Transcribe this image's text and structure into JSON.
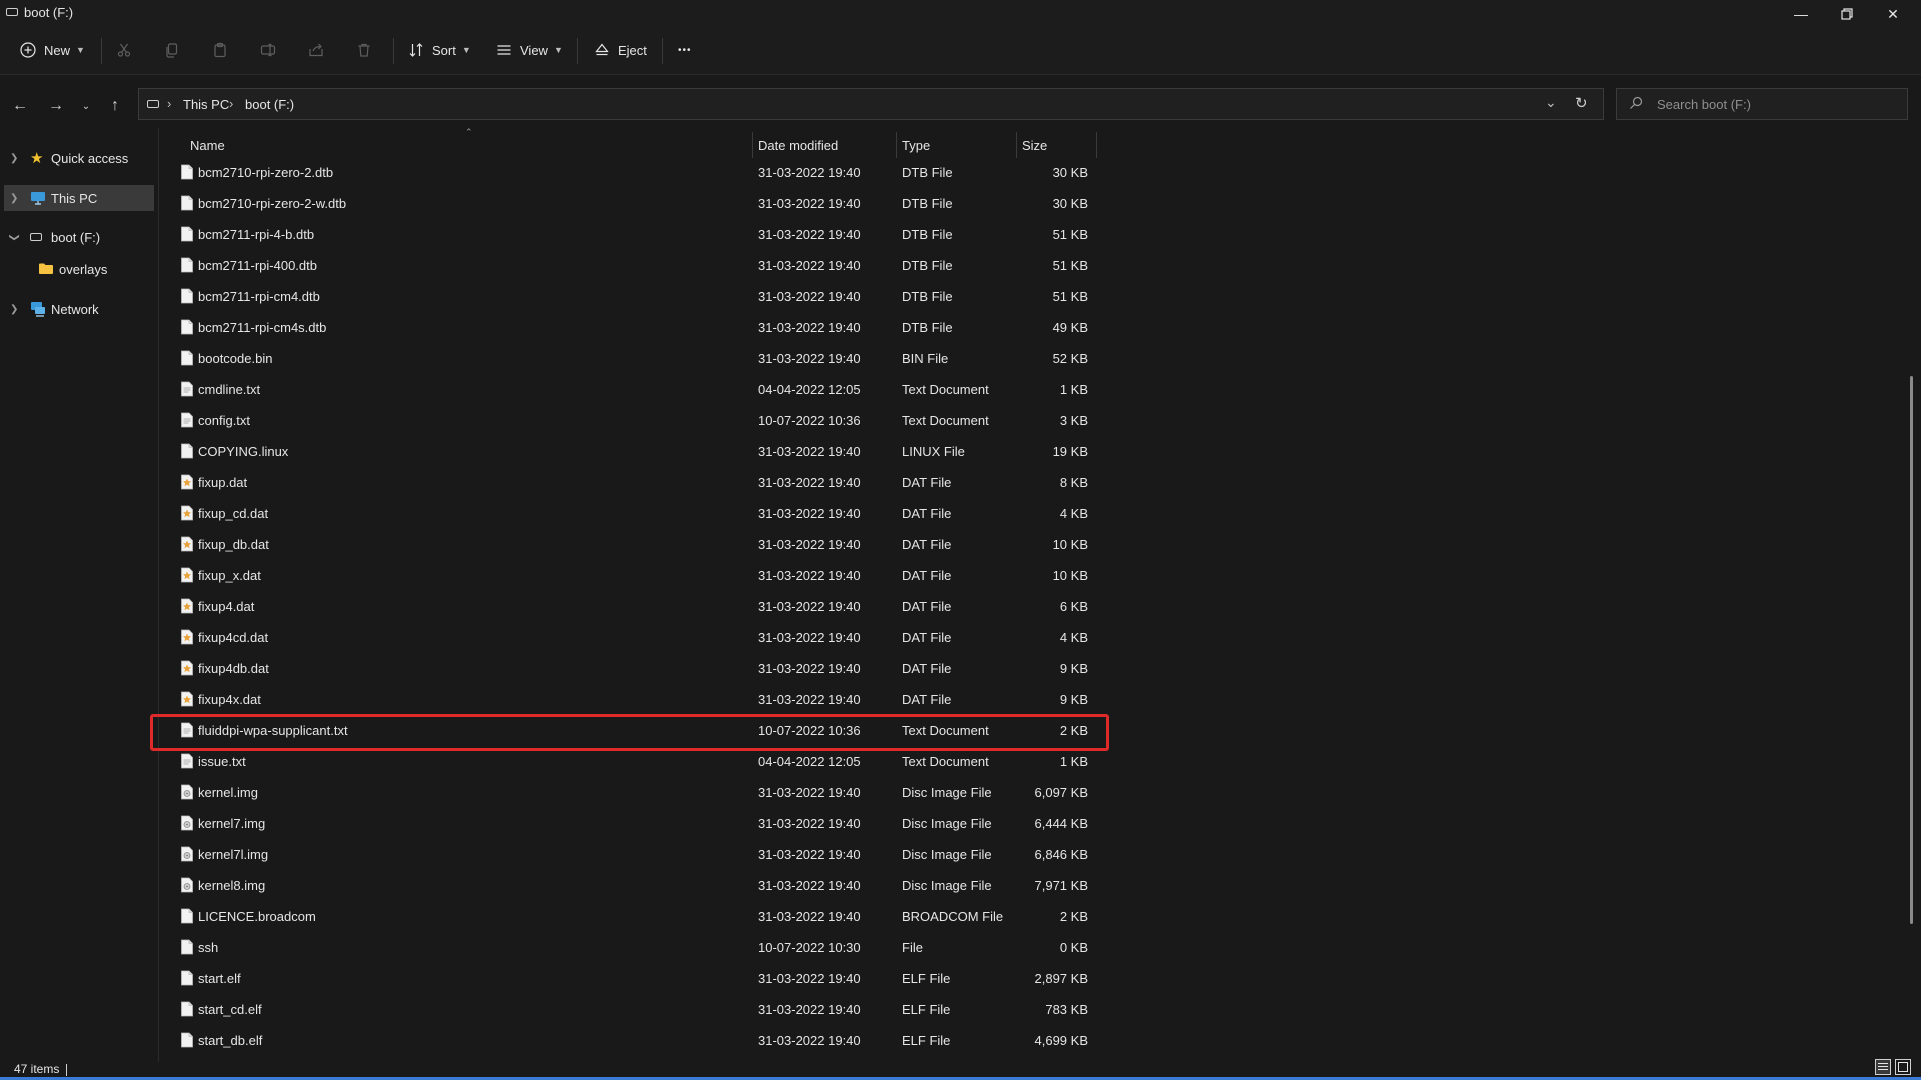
{
  "window": {
    "title": "boot (F:)",
    "controls": [
      "minimize",
      "restore",
      "close"
    ]
  },
  "toolbar": {
    "new_label": "New",
    "sort_label": "Sort",
    "view_label": "View",
    "eject_label": "Eject",
    "more_label": "•••"
  },
  "address": {
    "crumbs": [
      "This PC",
      "boot (F:)"
    ],
    "search_placeholder": "Search boot (F:)"
  },
  "nav": {
    "items": [
      {
        "label": "Quick access"
      },
      {
        "label": "This PC"
      },
      {
        "label": "boot (F:)"
      },
      {
        "label": "overlays"
      },
      {
        "label": "Network"
      }
    ]
  },
  "columns": {
    "name": "Name",
    "date": "Date modified",
    "type": "Type",
    "size": "Size"
  },
  "files": [
    {
      "name": "bcm2710-rpi-zero-2.dtb",
      "date": "31-03-2022 19:40",
      "type": "DTB File",
      "size": "30 KB",
      "icon": "file-icon"
    },
    {
      "name": "bcm2710-rpi-zero-2-w.dtb",
      "date": "31-03-2022 19:40",
      "type": "DTB File",
      "size": "30 KB",
      "icon": "file-icon"
    },
    {
      "name": "bcm2711-rpi-4-b.dtb",
      "date": "31-03-2022 19:40",
      "type": "DTB File",
      "size": "51 KB",
      "icon": "file-icon"
    },
    {
      "name": "bcm2711-rpi-400.dtb",
      "date": "31-03-2022 19:40",
      "type": "DTB File",
      "size": "51 KB",
      "icon": "file-icon"
    },
    {
      "name": "bcm2711-rpi-cm4.dtb",
      "date": "31-03-2022 19:40",
      "type": "DTB File",
      "size": "51 KB",
      "icon": "file-icon"
    },
    {
      "name": "bcm2711-rpi-cm4s.dtb",
      "date": "31-03-2022 19:40",
      "type": "DTB File",
      "size": "49 KB",
      "icon": "file-icon"
    },
    {
      "name": "bootcode.bin",
      "date": "31-03-2022 19:40",
      "type": "BIN File",
      "size": "52 KB",
      "icon": "file-icon"
    },
    {
      "name": "cmdline.txt",
      "date": "04-04-2022 12:05",
      "type": "Text Document",
      "size": "1 KB",
      "icon": "text-file-icon"
    },
    {
      "name": "config.txt",
      "date": "10-07-2022 10:36",
      "type": "Text Document",
      "size": "3 KB",
      "icon": "text-file-icon"
    },
    {
      "name": "COPYING.linux",
      "date": "31-03-2022 19:40",
      "type": "LINUX File",
      "size": "19 KB",
      "icon": "file-icon"
    },
    {
      "name": "fixup.dat",
      "date": "31-03-2022 19:40",
      "type": "DAT File",
      "size": "8 KB",
      "icon": "dat-file-icon"
    },
    {
      "name": "fixup_cd.dat",
      "date": "31-03-2022 19:40",
      "type": "DAT File",
      "size": "4 KB",
      "icon": "dat-file-icon"
    },
    {
      "name": "fixup_db.dat",
      "date": "31-03-2022 19:40",
      "type": "DAT File",
      "size": "10 KB",
      "icon": "dat-file-icon"
    },
    {
      "name": "fixup_x.dat",
      "date": "31-03-2022 19:40",
      "type": "DAT File",
      "size": "10 KB",
      "icon": "dat-file-icon"
    },
    {
      "name": "fixup4.dat",
      "date": "31-03-2022 19:40",
      "type": "DAT File",
      "size": "6 KB",
      "icon": "dat-file-icon"
    },
    {
      "name": "fixup4cd.dat",
      "date": "31-03-2022 19:40",
      "type": "DAT File",
      "size": "4 KB",
      "icon": "dat-file-icon"
    },
    {
      "name": "fixup4db.dat",
      "date": "31-03-2022 19:40",
      "type": "DAT File",
      "size": "9 KB",
      "icon": "dat-file-icon"
    },
    {
      "name": "fixup4x.dat",
      "date": "31-03-2022 19:40",
      "type": "DAT File",
      "size": "9 KB",
      "icon": "dat-file-icon"
    },
    {
      "name": "fluiddpi-wpa-supplicant.txt",
      "date": "10-07-2022 10:36",
      "type": "Text Document",
      "size": "2 KB",
      "icon": "text-file-icon",
      "highlighted": true
    },
    {
      "name": "issue.txt",
      "date": "04-04-2022 12:05",
      "type": "Text Document",
      "size": "1 KB",
      "icon": "text-file-icon"
    },
    {
      "name": "kernel.img",
      "date": "31-03-2022 19:40",
      "type": "Disc Image File",
      "size": "6,097 KB",
      "icon": "disc-image-icon"
    },
    {
      "name": "kernel7.img",
      "date": "31-03-2022 19:40",
      "type": "Disc Image File",
      "size": "6,444 KB",
      "icon": "disc-image-icon"
    },
    {
      "name": "kernel7l.img",
      "date": "31-03-2022 19:40",
      "type": "Disc Image File",
      "size": "6,846 KB",
      "icon": "disc-image-icon"
    },
    {
      "name": "kernel8.img",
      "date": "31-03-2022 19:40",
      "type": "Disc Image File",
      "size": "7,971 KB",
      "icon": "disc-image-icon"
    },
    {
      "name": "LICENCE.broadcom",
      "date": "31-03-2022 19:40",
      "type": "BROADCOM File",
      "size": "2 KB",
      "icon": "file-icon"
    },
    {
      "name": "ssh",
      "date": "10-07-2022 10:30",
      "type": "File",
      "size": "0 KB",
      "icon": "file-icon"
    },
    {
      "name": "start.elf",
      "date": "31-03-2022 19:40",
      "type": "ELF File",
      "size": "2,897 KB",
      "icon": "file-icon"
    },
    {
      "name": "start_cd.elf",
      "date": "31-03-2022 19:40",
      "type": "ELF File",
      "size": "783 KB",
      "icon": "file-icon"
    },
    {
      "name": "start_db.elf",
      "date": "31-03-2022 19:40",
      "type": "ELF File",
      "size": "4,699 KB",
      "icon": "file-icon"
    }
  ],
  "status": {
    "item_count": "47 items"
  },
  "colors": {
    "accent": "#3a7bd5",
    "highlight_box": "#e02a2a",
    "star": "#f2c230",
    "folder": "#f5c242"
  }
}
